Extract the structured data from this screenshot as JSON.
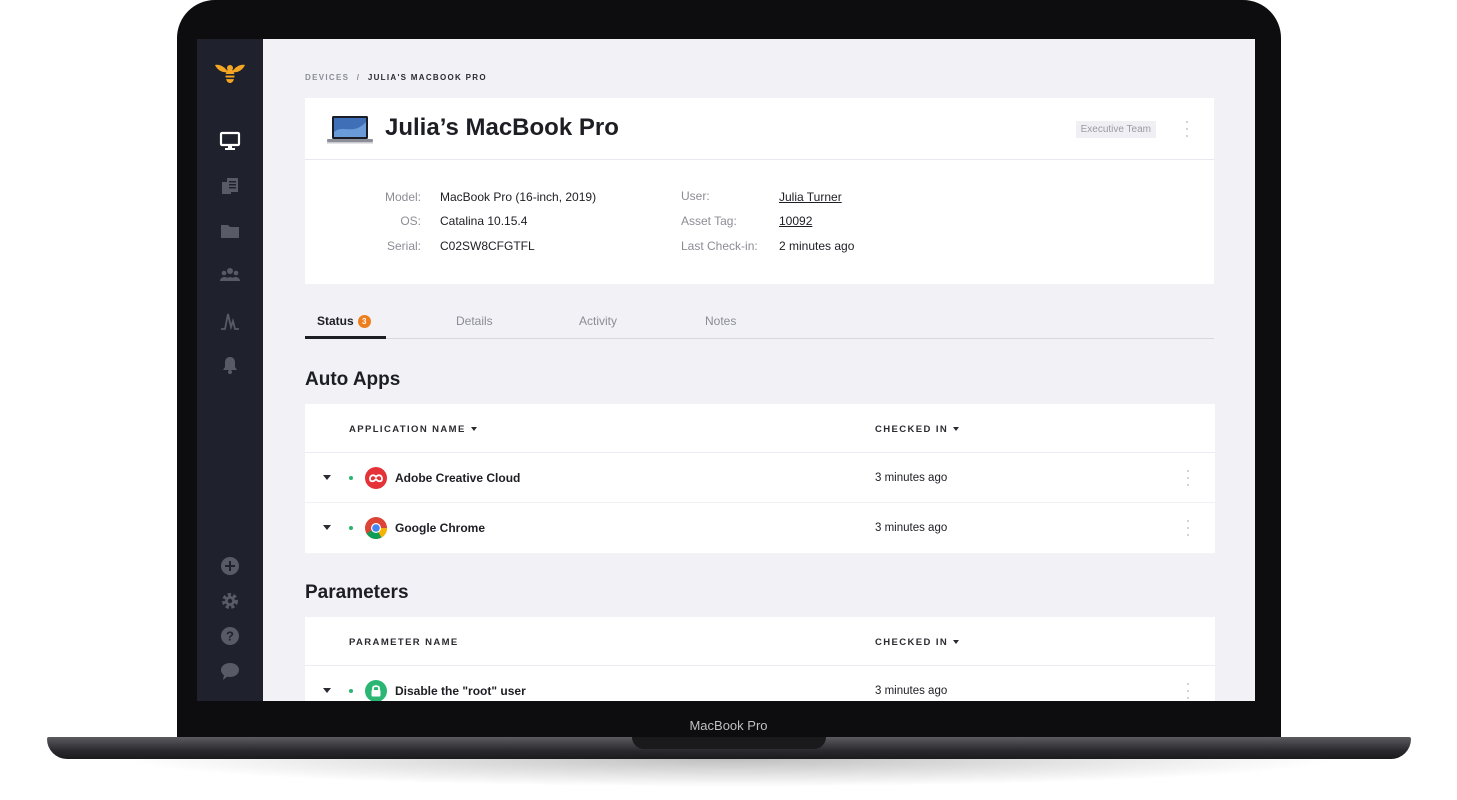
{
  "device_label": "MacBook Pro",
  "breadcrumb": {
    "parent": "DEVICES",
    "separator": "/",
    "current": "JULIA'S MACBOOK PRO"
  },
  "sidebar": {
    "items": [
      {
        "icon": "bee-logo-icon"
      },
      {
        "icon": "monitor-icon"
      },
      {
        "icon": "library-icon"
      },
      {
        "icon": "folder-icon"
      },
      {
        "icon": "people-icon"
      },
      {
        "icon": "activity-icon"
      },
      {
        "icon": "bell-icon"
      }
    ],
    "bottom_items": [
      {
        "icon": "plus-circle-icon"
      },
      {
        "icon": "gear-icon"
      },
      {
        "icon": "help-icon"
      },
      {
        "icon": "chat-icon"
      }
    ]
  },
  "device": {
    "title": "Julia’s MacBook Pro",
    "team": "Executive Team",
    "info_left": [
      {
        "label": "Model:",
        "value": "MacBook Pro (16-inch, 2019)"
      },
      {
        "label": "OS:",
        "value": "Catalina 10.15.4"
      },
      {
        "label": "Serial:",
        "value": "C02SW8CFGTFL"
      }
    ],
    "info_right": [
      {
        "label": "User:",
        "value": "Julia Turner"
      },
      {
        "label": "Asset Tag:",
        "value": "10092"
      },
      {
        "label": "Last Check-in:",
        "value": "2 minutes ago"
      }
    ]
  },
  "tabs": [
    {
      "label": "Status",
      "badge": "3"
    },
    {
      "label": "Details"
    },
    {
      "label": "Activity"
    },
    {
      "label": "Notes"
    }
  ],
  "auto_apps": {
    "title": "Auto Apps",
    "columns": [
      "APPLICATION NAME",
      "CHECKED IN"
    ],
    "rows": [
      {
        "name": "Adobe Creative Cloud",
        "checked_in": "3 minutes ago",
        "icon": "adobe-creative-cloud-icon",
        "status_color": "#2bb673"
      },
      {
        "name": "Google Chrome",
        "checked_in": "3 minutes ago",
        "icon": "google-chrome-icon",
        "status_color": "#2bb673"
      }
    ]
  },
  "parameters": {
    "title": "Parameters",
    "columns": [
      "PARAMETER NAME",
      "CHECKED IN"
    ],
    "rows": [
      {
        "name": "Disable the \"root\" user",
        "checked_in": "3 minutes ago",
        "icon": "lock-icon",
        "status_color": "#2bb673"
      }
    ]
  },
  "colors": {
    "accent": "#f07d1c",
    "sidebar_bg": "#1f212c",
    "status_ok": "#2bb673",
    "logo": "#f5a623"
  }
}
